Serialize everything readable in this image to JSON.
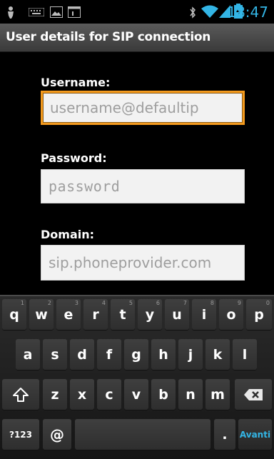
{
  "status_bar": {
    "time": "18:47",
    "icons": [
      "person-icon",
      "keyboard-icon",
      "image-icon",
      "window-icon",
      "bluetooth-icon",
      "wifi-icon",
      "signal-icon",
      "battery-charging-icon"
    ]
  },
  "title": "User details for SIP connection",
  "form": {
    "username_label": "Username:",
    "username_placeholder": "username@defaultip",
    "password_label": "Password:",
    "password_placeholder": "password",
    "domain_label": "Domain:",
    "domain_placeholder": "sip.phoneprovider.com"
  },
  "keyboard": {
    "row1": [
      {
        "k": "q",
        "h": "1"
      },
      {
        "k": "w",
        "h": "2"
      },
      {
        "k": "e",
        "h": "3"
      },
      {
        "k": "r",
        "h": "4"
      },
      {
        "k": "t",
        "h": "5"
      },
      {
        "k": "y",
        "h": "6"
      },
      {
        "k": "u",
        "h": "7"
      },
      {
        "k": "i",
        "h": "8"
      },
      {
        "k": "o",
        "h": "9"
      },
      {
        "k": "p",
        "h": "0"
      }
    ],
    "row2": [
      "a",
      "s",
      "d",
      "f",
      "g",
      "h",
      "j",
      "k",
      "l"
    ],
    "row3": [
      "z",
      "x",
      "c",
      "v",
      "b",
      "n",
      "m"
    ],
    "symbols_label": "?123",
    "at_label": "@",
    "period_label": ".",
    "action_label": "Avanti",
    "shift_icon": "shift-icon",
    "backspace_icon": "backspace-icon"
  }
}
